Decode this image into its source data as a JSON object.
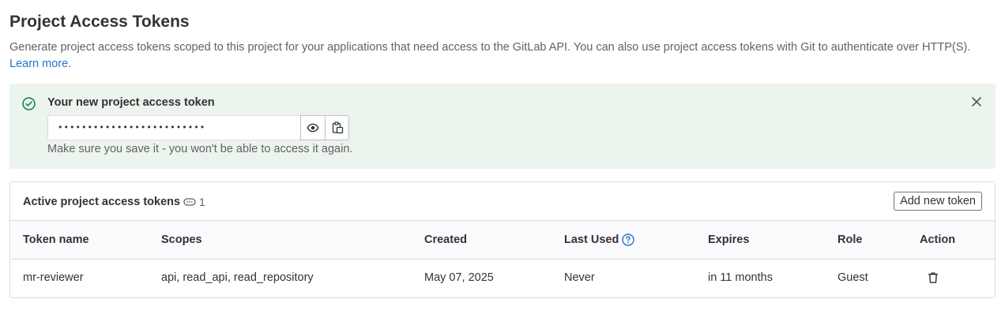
{
  "page": {
    "title": "Project Access Tokens",
    "description": "Generate project access tokens scoped to this project for your applications that need access to the GitLab API. You can also use project access tokens with Git to authenticate over HTTP(S).",
    "learn_more": "Learn more."
  },
  "alert": {
    "title": "Your new project access token",
    "token_masked": "•••••••••••••••••••••••••",
    "help": "Make sure you save it - you won't be able to access it again.",
    "icons": [
      "check-circle-icon",
      "close-icon",
      "eye-icon",
      "copy-icon"
    ],
    "color": "#ecf4ee"
  },
  "active_tokens": {
    "title": "Active project access tokens",
    "count": "1",
    "add_button": "Add new token",
    "columns": {
      "name": "Token name",
      "scopes": "Scopes",
      "created": "Created",
      "last_used": "Last Used",
      "expires": "Expires",
      "role": "Role",
      "action": "Action"
    },
    "rows": [
      {
        "name": "mr-reviewer",
        "scopes": "api, read_api, read_repository",
        "created": "May 07, 2025",
        "last_used": "Never",
        "expires": "in 11 months",
        "role": "Guest",
        "action_icon": "trash-icon"
      }
    ]
  },
  "colors": {
    "link": "#1f75cb",
    "success": "#108548",
    "text": "#333238",
    "muted": "#626168"
  }
}
